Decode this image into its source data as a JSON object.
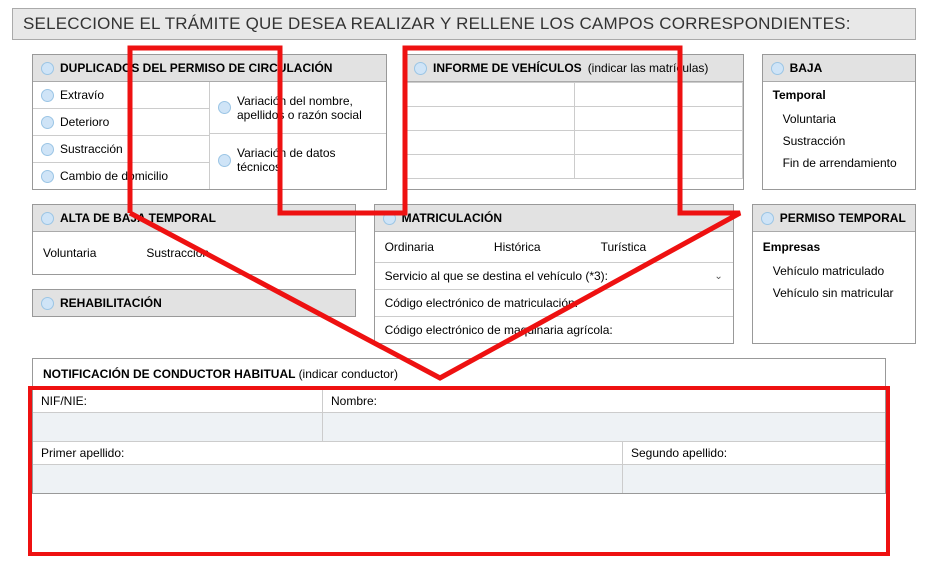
{
  "title": "SELECCIONE EL TRÁMITE QUE DESEA REALIZAR Y RELLENE LOS CAMPOS CORRESPONDIENTES:",
  "dup": {
    "header": "DUPLICADOS DEL PERMISO DE CIRCULACIÓN",
    "left": [
      "Extravío",
      "Deterioro",
      "Sustracción",
      "Cambio de domicilio"
    ],
    "right": [
      "Variación del nombre, apellidos o razón social",
      "Variación de datos técnicos"
    ]
  },
  "inf": {
    "header": "INFORME DE VEHÍCULOS",
    "hint": "(indicar las matrículas)"
  },
  "baja": {
    "header": "BAJA",
    "sub": "Temporal",
    "items": [
      "Voluntaria",
      "Sustracción",
      "Fin de arrendamiento"
    ]
  },
  "alta": {
    "header": "ALTA DE BAJA TEMPORAL",
    "opts": [
      "Voluntaria",
      "Sustracción"
    ]
  },
  "rehab": {
    "header": "REHABILITACIÓN"
  },
  "matr": {
    "header": "MATRICULACIÓN",
    "opts": [
      "Ordinaria",
      "Histórica",
      "Turística"
    ],
    "line1": "Servicio al que se destina el vehículo (*3):",
    "line2": "Código electrónico de matriculación:",
    "line3": "Código electrónico de maquinaria agrícola:"
  },
  "perm": {
    "header": "PERMISO TEMPORAL",
    "sub": "Empresas",
    "items": [
      "Vehículo matriculado",
      "Vehículo sin matricular"
    ]
  },
  "notif": {
    "header": "NOTIFICACIÓN DE CONDUCTOR HABITUAL",
    "hint": "(indicar conductor)",
    "nif": "NIF/NIE:",
    "nombre": "Nombre:",
    "ape1": "Primer apellido:",
    "ape2": "Segundo apellido:"
  }
}
